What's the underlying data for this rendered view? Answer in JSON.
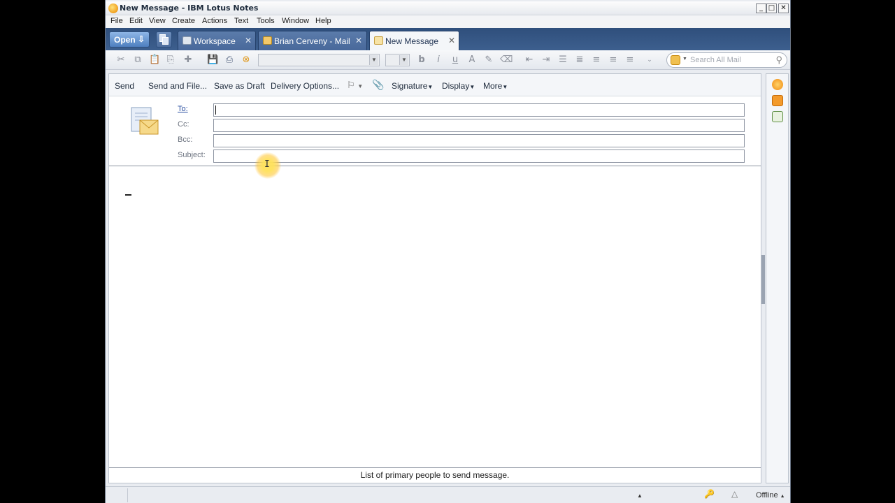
{
  "window": {
    "title": "New Message - IBM Lotus Notes",
    "controls": [
      "_",
      "□",
      "✕"
    ]
  },
  "menu": [
    "File",
    "Edit",
    "View",
    "Create",
    "Actions",
    "Text",
    "Tools",
    "Window",
    "Help"
  ],
  "tabs": {
    "open_label": "Open",
    "items": [
      {
        "label": "Workspace",
        "close": "✕"
      },
      {
        "label": "Brian Cerveny - Mail",
        "close": "✕"
      },
      {
        "label": "New Message",
        "close": "✕"
      }
    ]
  },
  "toolbar": {
    "search_placeholder": "Search All Mail"
  },
  "actions": {
    "send": "Send",
    "send_and_file": "Send and File...",
    "save_as_draft": "Save as Draft",
    "delivery_options": "Delivery Options...",
    "signature": "Signature",
    "display": "Display",
    "more": "More"
  },
  "form": {
    "to_label": "To:",
    "cc_label": "Cc:",
    "bcc_label": "Bcc:",
    "subject_label": "Subject:",
    "to_value": "",
    "cc_value": "",
    "bcc_value": "",
    "subject_value": ""
  },
  "hint": "List of primary people to send message.",
  "status": {
    "offline_label": "Offline"
  },
  "colors": {
    "tabbar": "#3d5f8e",
    "accent": "#f0a020"
  }
}
